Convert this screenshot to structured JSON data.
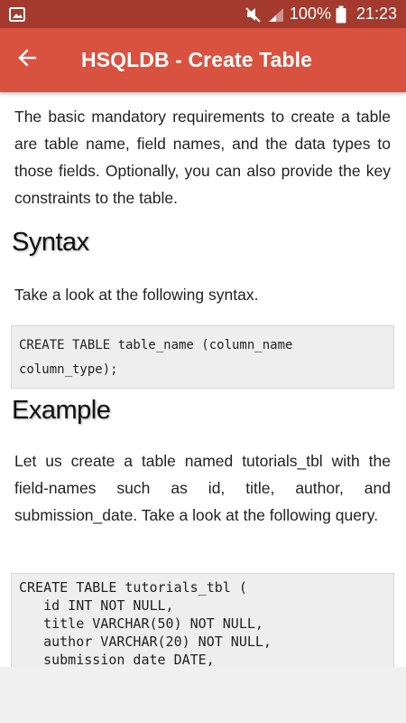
{
  "status_bar": {
    "battery_percent": "100%",
    "time": "21:23",
    "icons": [
      "gallery-icon",
      "mute-icon",
      "signal-icon",
      "battery-icon"
    ]
  },
  "app_bar": {
    "title": "HSQLDB - Create Table",
    "back_icon": "arrow-left-icon",
    "color": "#d9513f",
    "status_color": "#a33a2d"
  },
  "content": {
    "intro": "The basic mandatory requirements to create a table are table name, field names, and the data types to those fields. Optionally, you can also provide the key constraints to the table.",
    "syntax_heading": "Syntax",
    "syntax_text": "Take a look at the following syntax.",
    "syntax_code": [
      "CREATE TABLE table_name (column_name",
      "column_type);"
    ],
    "example_heading": "Example",
    "example_text": "Let us create a table named tutorials_tbl with the field-names such as id, title, author, and submission_date. Take a look at the following query.",
    "example_code": [
      "CREATE TABLE tutorials_tbl (",
      "   id INT NOT NULL,",
      "   title VARCHAR(50) NOT NULL,",
      "   author VARCHAR(20) NOT NULL,",
      "   submission_date DATE,"
    ]
  }
}
